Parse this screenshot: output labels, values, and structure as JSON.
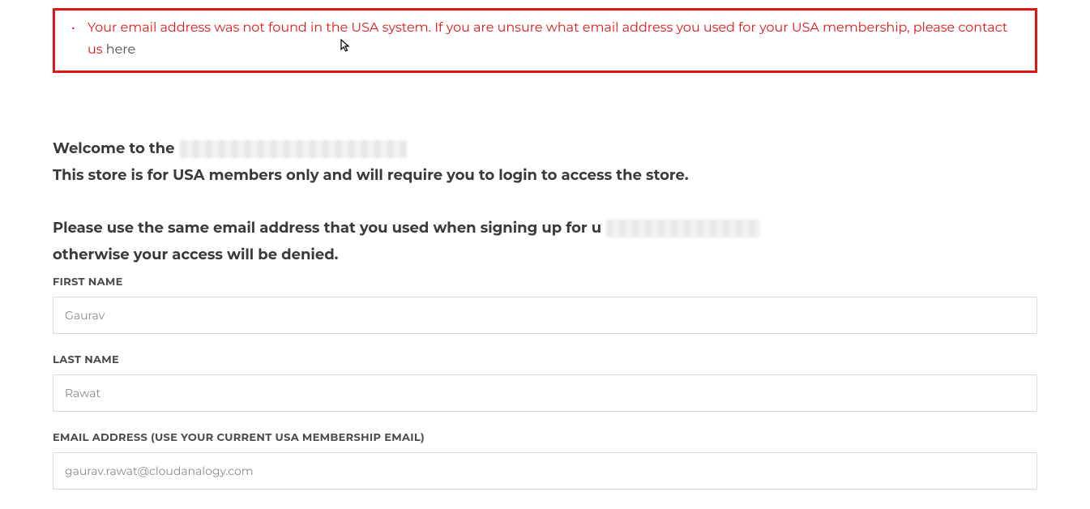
{
  "error": {
    "message": "Your email address was not found in the USA system. If you are unsure what email address you used for your USA membership, please contact us ",
    "link_text": "here"
  },
  "intro": {
    "line1_a": "Welcome to the",
    "line1_b": "This store is for USA members only and will require you to login to access the store.",
    "line2_a": "Please use the same email address that you used when signing up for u",
    "line2_b": "otherwise your access will be denied."
  },
  "form": {
    "first_name": {
      "label": "FIRST NAME",
      "value": "Gaurav"
    },
    "last_name": {
      "label": "LAST NAME",
      "value": "Rawat"
    },
    "email": {
      "label": "EMAIL ADDRESS (USE YOUR CURRENT USA MEMBERSHIP EMAIL)",
      "value": "gaurav.rawat@cloudanalogy.com"
    }
  }
}
